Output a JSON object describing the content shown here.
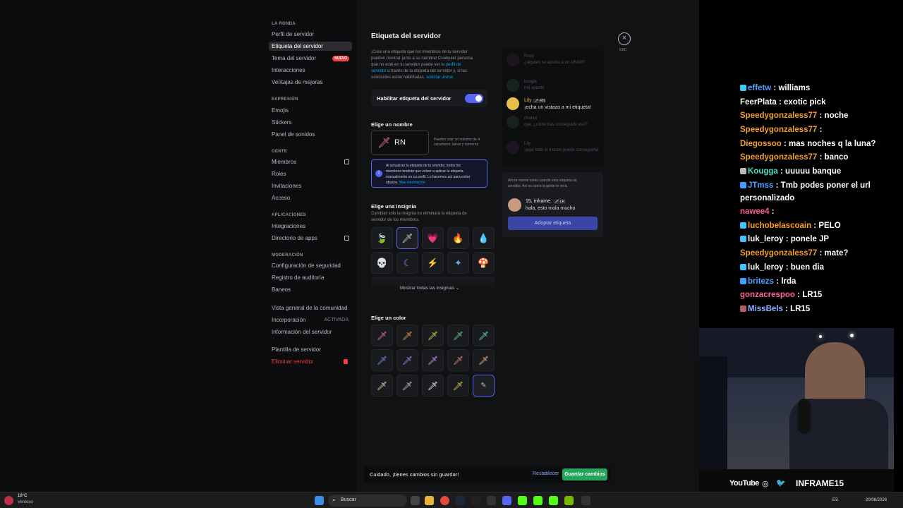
{
  "sidebar": {
    "server_header": "LA RONDA",
    "sections": [
      {
        "title": "",
        "items": [
          "Perfil de servidor",
          "Etiqueta del servidor",
          "Tema del servidor",
          "Interacciones",
          "Ventajas de mejoras"
        ]
      },
      {
        "title": "EXPRESIÓN",
        "items": [
          "Emojis",
          "Stickers",
          "Panel de sonidos"
        ]
      },
      {
        "title": "GENTE",
        "items": [
          "Miembros",
          "Roles",
          "Invitaciones",
          "Acceso"
        ]
      },
      {
        "title": "APLICACIONES",
        "items": [
          "Integraciones",
          "Directorio de apps"
        ]
      },
      {
        "title": "MODERACIÓN",
        "items": [
          "Configuración de seguridad",
          "Registro de auditoría",
          "Baneos"
        ]
      },
      {
        "title": "",
        "items": [
          "Vista general de la comunidad",
          "Incorporación",
          "Información del servidor"
        ]
      },
      {
        "title": "",
        "items": [
          "Plantilla de servidor",
          "Eliminar servidor"
        ]
      }
    ],
    "nuevo_badge": "NUEVO",
    "activada": "ACTIVADA"
  },
  "main": {
    "title": "Etiqueta del servidor",
    "esc": "ESC",
    "intro_1": "¡Crea una etiqueta que los miembros de tu servidor",
    "intro_2": "puedan mostrar junto a su nombre! Cualquier persona",
    "intro_3": "que no esté en tu servidor puede ver tu",
    "intro_link1": "perfil de",
    "intro_4a": "servidor",
    "intro_4b": "a través de la etiqueta del servidor y, si las",
    "intro_5": "solicitudes están habilitadas,",
    "intro_link2": "solicitar unirse",
    "toggle_label": "Habilitar etiqueta del servidor",
    "name_label": "Elige un nombre",
    "name_value": "RN",
    "name_hint_1": "Puedes usar un máximo de 4",
    "name_hint_2": "caracteres, letras y números.",
    "info_1": "Al actualizar la etiqueta de tu servidor, todos los",
    "info_2": "miembros tendrán que volver a aplicar la etiqueta",
    "info_3": "manualmente en su perfil. Lo hacemos así para evitar",
    "info_4": "abusos.",
    "info_link": "Más información",
    "badge_label": "Elige una insignia",
    "badge_desc_1": "Cambiar solo la insignia no eliminará la etiqueta de",
    "badge_desc_2": "servidor de los miembros.",
    "show_all": "Mostrar todas las insignias",
    "color_label": "Elige un color",
    "unsaved": "Cuidado, ¡tienes cambios sin guardar!",
    "reset": "Restablecer",
    "save": "Guardar cambios"
  },
  "preview": {
    "messages": [
      {
        "name": "Rosy",
        "text": "¿alguien se apunta a un ARAM?"
      },
      {
        "name": "boogie",
        "text": "me apunto"
      },
      {
        "name": "Lily",
        "tag": "RN",
        "text": "¡echa un vistazo a mi etiqueta!"
      },
      {
        "name": "charlot",
        "text": "oye, ¿cómo has conseguido eso?"
      },
      {
        "name": "Lily",
        "text": "¡aquí todo el mundo puede conseguirla!"
      }
    ],
    "notice_1": "Ahora mismo estás usando esta etiqueta de",
    "notice_2": "servidor. Así es como la gente te verá.",
    "user": "15, inframe.",
    "user_tag": "LR",
    "user_msg": "hala, esto mola mucho",
    "adopt": "Adoptar etiqueta"
  },
  "chat": [
    {
      "user": "effetw",
      "color": "#4fa3ff",
      "msg": "williams"
    },
    {
      "user": "FeerPlata",
      "color": "#ffffff",
      "msg": "exotic pick"
    },
    {
      "user": "Speedygonzaless77",
      "color": "#f0a030",
      "msg": "noche"
    },
    {
      "user": "Speedygonzaless77",
      "color": "#f0a030",
      "msg": ""
    },
    {
      "user": "Diegossoo",
      "color": "#f0a030",
      "msg": "mas noches q la luna?"
    },
    {
      "user": "Speedygonzaless77",
      "color": "#f0a030",
      "msg": "banco"
    },
    {
      "user": "Kougga",
      "color": "#4fdcc0",
      "msg": "uuuuu banque"
    },
    {
      "user": "JTmss",
      "color": "#4fa3ff",
      "msg": "Tmb podes poner el url"
    },
    {
      "user": "",
      "color": "#ffffff",
      "msg": "personalizado"
    },
    {
      "user": "nawee4",
      "color": "#ff5c8a",
      "msg": ""
    },
    {
      "user": "luchobelascoain",
      "color": "#ffa020",
      "msg": "PELO"
    },
    {
      "user": "luk_leroy",
      "color": "#ffffff",
      "msg": "ponele JP"
    },
    {
      "user": "Speedygonzaless77",
      "color": "#f0a030",
      "msg": "mate?"
    },
    {
      "user": "luk_leroy",
      "color": "#ffffff",
      "msg": "buen dia"
    },
    {
      "user": "britezs",
      "color": "#4fa3ff",
      "msg": "lrda"
    },
    {
      "user": "gonzacrespoo",
      "color": "#ff6b8f",
      "msg": "LR15"
    },
    {
      "user": "MissBels",
      "color": "#8ab4ff",
      "msg": "LR15"
    }
  ],
  "cam_footer": {
    "yt": "YouTube",
    "handle": "INFRAME15"
  },
  "taskbar": {
    "temp": "18°C",
    "weather": "Ventoso",
    "search": "Buscar",
    "lang": "ES",
    "date": "20/08/2026"
  },
  "colors": {
    "accent": "#5865f2",
    "danger": "#f23f43",
    "success": "#23a55a"
  }
}
